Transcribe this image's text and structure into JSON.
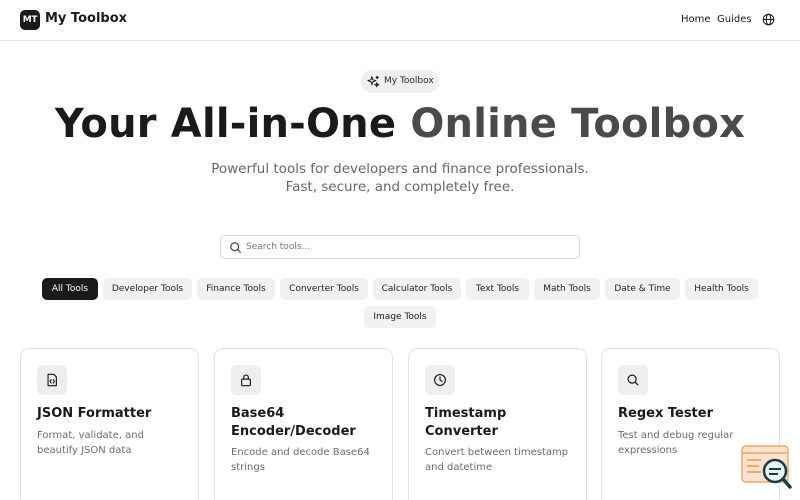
{
  "header": {
    "logo_text": "MT",
    "brand": "My Toolbox",
    "nav": {
      "home": "Home",
      "guides": "Guides"
    }
  },
  "hero": {
    "pill_label": "My Toolbox",
    "title_part1": "Your All-in-One ",
    "title_part2": "Online Toolbox",
    "subtitle": "Powerful tools for developers and finance professionals. Fast, secure, and completely free."
  },
  "search": {
    "placeholder": "Search tools...",
    "value": ""
  },
  "categories": [
    {
      "label": "All Tools",
      "active": true
    },
    {
      "label": "Developer Tools",
      "active": false
    },
    {
      "label": "Finance Tools",
      "active": false
    },
    {
      "label": "Converter Tools",
      "active": false
    },
    {
      "label": "Calculator Tools",
      "active": false
    },
    {
      "label": "Text Tools",
      "active": false
    },
    {
      "label": "Math Tools",
      "active": false
    },
    {
      "label": "Date & Time",
      "active": false
    },
    {
      "label": "Health Tools",
      "active": false
    },
    {
      "label": "Image Tools",
      "active": false
    }
  ],
  "tools": [
    {
      "icon": "code-file-icon",
      "title": "JSON Formatter",
      "description": "Format, validate, and beautify JSON data"
    },
    {
      "icon": "lock-icon",
      "title": "Base64 Encoder/Decoder",
      "description": "Encode and decode Base64 strings"
    },
    {
      "icon": "clock-icon",
      "title": "Timestamp Converter",
      "description": "Convert between timestamp and datetime"
    },
    {
      "icon": "search-icon",
      "title": "Regex Tester",
      "description": "Test and debug regular expressions"
    }
  ],
  "colors": {
    "primary": "#1a1a1a",
    "chip_bg": "#f1f1f1",
    "muted_text": "#6b6b6b",
    "widget_accent": "#f0a86a"
  }
}
